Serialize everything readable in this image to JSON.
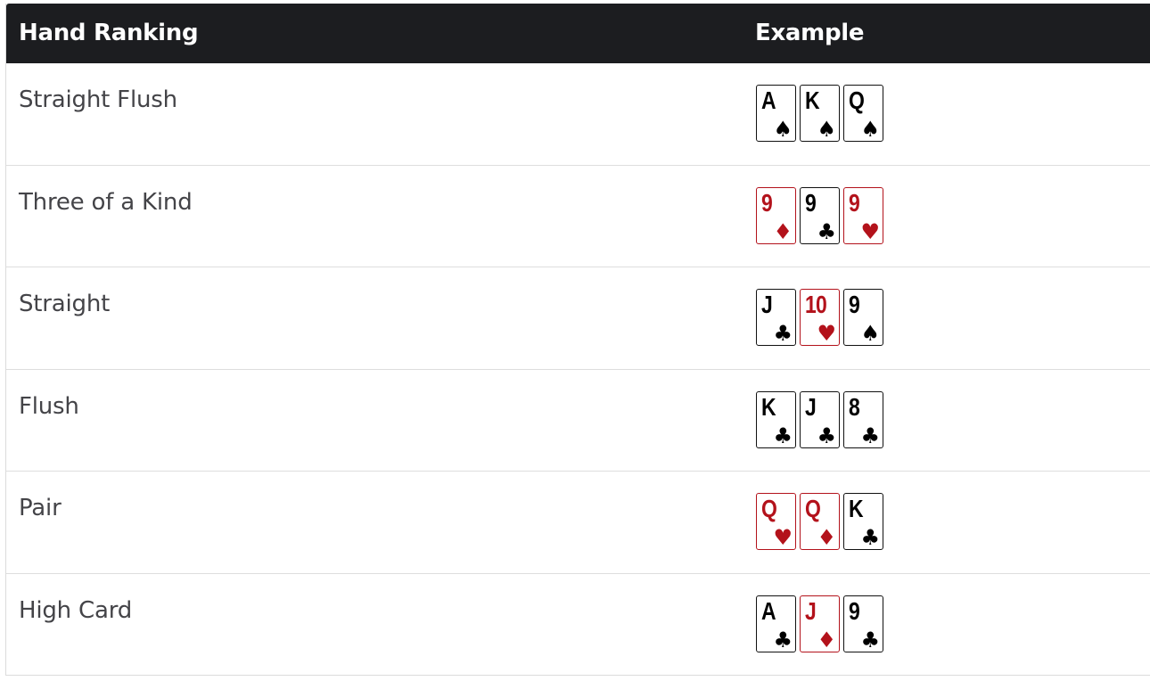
{
  "header": {
    "rank_label": "Hand Ranking",
    "example_label": "Example"
  },
  "suits": {
    "spades": "♠",
    "clubs": "♣",
    "hearts": "♥",
    "diamonds": "♦"
  },
  "colors": {
    "header_bg": "#1c1d20",
    "red_card": "#b3121b",
    "black_card": "#000000",
    "rank_text": "#444448"
  },
  "rows": [
    {
      "name": "Straight Flush",
      "cards": [
        {
          "value": "A",
          "suit": "spades"
        },
        {
          "value": "K",
          "suit": "spades"
        },
        {
          "value": "Q",
          "suit": "spades"
        }
      ]
    },
    {
      "name": "Three of a Kind",
      "cards": [
        {
          "value": "9",
          "suit": "diamonds"
        },
        {
          "value": "9",
          "suit": "clubs"
        },
        {
          "value": "9",
          "suit": "hearts"
        }
      ]
    },
    {
      "name": "Straight",
      "cards": [
        {
          "value": "J",
          "suit": "clubs"
        },
        {
          "value": "10",
          "suit": "hearts"
        },
        {
          "value": "9",
          "suit": "spades"
        }
      ]
    },
    {
      "name": "Flush",
      "cards": [
        {
          "value": "K",
          "suit": "clubs"
        },
        {
          "value": "J",
          "suit": "clubs"
        },
        {
          "value": "8",
          "suit": "clubs"
        }
      ]
    },
    {
      "name": "Pair",
      "cards": [
        {
          "value": "Q",
          "suit": "hearts"
        },
        {
          "value": "Q",
          "suit": "diamonds"
        },
        {
          "value": "K",
          "suit": "clubs"
        }
      ]
    },
    {
      "name": "High Card",
      "cards": [
        {
          "value": "A",
          "suit": "clubs"
        },
        {
          "value": "J",
          "suit": "diamonds"
        },
        {
          "value": "9",
          "suit": "clubs"
        }
      ]
    }
  ]
}
